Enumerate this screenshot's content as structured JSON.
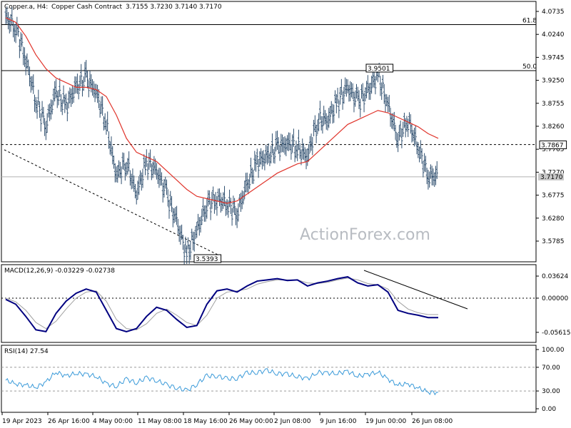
{
  "colors": {
    "background": "#ffffff",
    "border": "#000000",
    "price_bars": "#2f4f6f",
    "moving_average": "#e0342b",
    "macd_line": "#000080",
    "macd_signal": "#a0a0a0",
    "rsi_line": "#3a9ad9",
    "grid_dash": "#000000",
    "watermark": "#b8bcc2"
  },
  "header": {
    "symbol": "Copper.a, H4:",
    "instrument": "Copper Cash Contract",
    "ohlc": "3.7155 3.7230 3.7140 3.7170"
  },
  "watermark": "ActionForex.com",
  "price_axis_ticks": [
    "4.0735",
    "4.0240",
    "3.9745",
    "3.9250",
    "3.8755",
    "3.8260",
    "3.7765",
    "3.7270",
    "3.6775",
    "3.6280",
    "3.5785"
  ],
  "macd_axis_ticks": [
    "0.03624",
    "0.00000",
    "-0.05615"
  ],
  "rsi_axis_ticks": [
    "100.00",
    "70.00",
    "30.00",
    "0.00"
  ],
  "time_axis_ticks": [
    "19 Apr 2023",
    "26 Apr 16:00",
    "4 May 00:00",
    "11 May 08:00",
    "18 May 16:00",
    "26 May 00:00",
    "2 Jun 08:00",
    "9 Jun 16:00",
    "19 Jun 00:00",
    "26 Jun 08:00"
  ],
  "annotations": {
    "fib_618": "61.8",
    "fib_50": "50.0",
    "high_label": "3.9501",
    "low_label": "3.5393",
    "resistance_label": "3.7867",
    "current_label": "3.7170"
  },
  "chart_data": [
    {
      "type": "line",
      "title": "Copper.a, H4: Copper Cash Contract",
      "ylim": [
        3.548,
        4.09
      ],
      "x": [
        "19 Apr 2023",
        "26 Apr 16:00",
        "4 May 00:00",
        "11 May 08:00",
        "18 May 16:00",
        "26 May 00:00",
        "2 Jun 08:00",
        "9 Jun 16:00",
        "19 Jun 00:00",
        "26 Jun 08:00"
      ],
      "series": [
        {
          "values": [
            4.06,
            4.04,
            3.97,
            3.88,
            3.83,
            3.9,
            3.87,
            3.91,
            3.93,
            3.9,
            3.83,
            3.72,
            3.75,
            3.68,
            3.75,
            3.73,
            3.68,
            3.62,
            3.55,
            3.6,
            3.66,
            3.67,
            3.66,
            3.64,
            3.7,
            3.75,
            3.76,
            3.78,
            3.79,
            3.78,
            3.76,
            3.84,
            3.84,
            3.88,
            3.91,
            3.88,
            3.9,
            3.94,
            3.87,
            3.8,
            3.84,
            3.78,
            3.72,
            3.717
          ]
        },
        {
          "values": [
            4.06,
            4.05,
            4.02,
            3.98,
            3.95,
            3.93,
            3.92,
            3.91,
            3.91,
            3.905,
            3.89,
            3.85,
            3.8,
            3.77,
            3.76,
            3.75,
            3.73,
            3.71,
            3.69,
            3.675,
            3.67,
            3.665,
            3.66,
            3.665,
            3.68,
            3.695,
            3.71,
            3.725,
            3.735,
            3.745,
            3.75,
            3.77,
            3.79,
            3.81,
            3.83,
            3.84,
            3.85,
            3.86,
            3.855,
            3.845,
            3.835,
            3.825,
            3.81,
            3.8
          ]
        }
      ],
      "horizontal_lines": [
        {
          "label": "61.8",
          "value": 4.045
        },
        {
          "label": "50.0",
          "value": 3.946
        },
        {
          "label": "3.7867",
          "value": 3.7867
        },
        {
          "label": "3.7170",
          "value": 3.717
        }
      ]
    },
    {
      "type": "line",
      "title": "MACD(12,26,9) -0.03229 -0.02738",
      "ylim": [
        -0.068,
        0.048
      ],
      "series": [
        {
          "name": "MACD",
          "values": [
            -0.002,
            -0.01,
            -0.03,
            -0.052,
            -0.055,
            -0.025,
            -0.005,
            0.008,
            0.015,
            0.01,
            -0.02,
            -0.05,
            -0.055,
            -0.05,
            -0.03,
            -0.015,
            -0.02,
            -0.035,
            -0.048,
            -0.045,
            -0.01,
            0.012,
            0.015,
            0.01,
            0.02,
            0.028,
            0.03,
            0.032,
            0.029,
            0.03,
            0.02,
            0.025,
            0.028,
            0.032,
            0.035,
            0.025,
            0.02,
            0.022,
            0.01,
            -0.02,
            -0.025,
            -0.028,
            -0.032,
            -0.032
          ]
        },
        {
          "name": "Signal",
          "values": [
            0.0,
            -0.006,
            -0.02,
            -0.04,
            -0.05,
            -0.038,
            -0.018,
            0.0,
            0.01,
            0.012,
            -0.005,
            -0.035,
            -0.05,
            -0.052,
            -0.042,
            -0.025,
            -0.018,
            -0.028,
            -0.04,
            -0.045,
            -0.028,
            0.0,
            0.01,
            0.012,
            0.015,
            0.023,
            0.027,
            0.03,
            0.03,
            0.03,
            0.025,
            0.024,
            0.026,
            0.03,
            0.033,
            0.03,
            0.024,
            0.022,
            0.015,
            -0.005,
            -0.018,
            -0.024,
            -0.027,
            -0.027
          ]
        }
      ],
      "annotations": [
        "trendline from 18 Jun to 28 Jun"
      ]
    },
    {
      "type": "line",
      "title": "RSI(14) 27.54",
      "ylim": [
        0,
        100
      ],
      "series": [
        {
          "name": "RSI(14)",
          "values": [
            48,
            42,
            40,
            36,
            45,
            62,
            55,
            60,
            58,
            55,
            42,
            38,
            50,
            44,
            52,
            48,
            40,
            36,
            30,
            42,
            55,
            56,
            50,
            52,
            60,
            62,
            64,
            60,
            58,
            55,
            50,
            62,
            60,
            60,
            63,
            55,
            58,
            62,
            50,
            40,
            42,
            35,
            28,
            27.54
          ]
        }
      ],
      "levels": [
        70,
        30
      ]
    }
  ]
}
